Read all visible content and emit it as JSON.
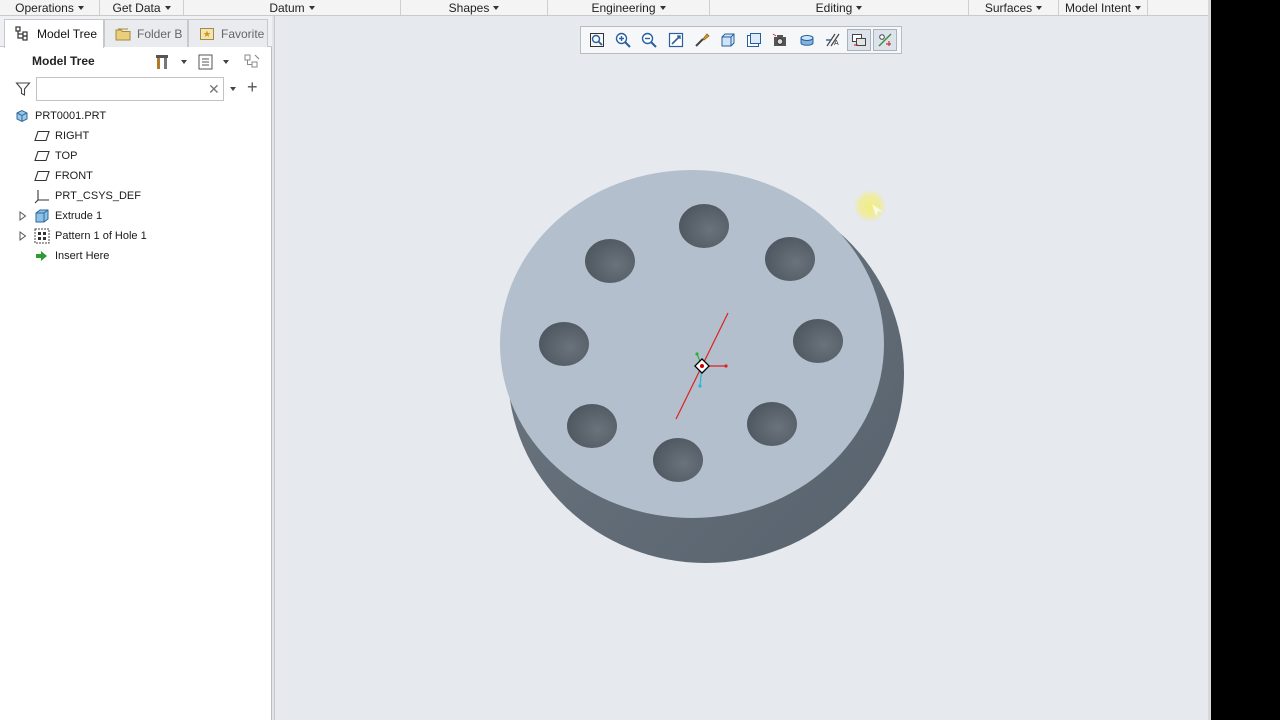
{
  "ribbon": {
    "groups": [
      {
        "label": "Operations"
      },
      {
        "label": "Get Data"
      },
      {
        "label": "Datum"
      },
      {
        "label": "Shapes"
      },
      {
        "label": "Engineering"
      },
      {
        "label": "Editing"
      },
      {
        "label": "Surfaces"
      },
      {
        "label": "Model Intent"
      }
    ]
  },
  "panel": {
    "tabs": [
      {
        "label": "Model Tree",
        "icon": "model-tree-icon",
        "active": true
      },
      {
        "label": "Folder B",
        "icon": "folder-browser-icon",
        "active": false
      },
      {
        "label": "Favorite",
        "icon": "favorites-icon",
        "active": false
      }
    ],
    "tree_title": "Model Tree",
    "search": {
      "value": "",
      "placeholder": ""
    },
    "nodes": [
      {
        "label": "PRT0001.PRT",
        "icon": "part-icon"
      },
      {
        "label": "RIGHT",
        "icon": "datum-plane-icon"
      },
      {
        "label": "TOP",
        "icon": "datum-plane-icon"
      },
      {
        "label": "FRONT",
        "icon": "datum-plane-icon"
      },
      {
        "label": "PRT_CSYS_DEF",
        "icon": "coordinate-system-icon"
      },
      {
        "label": "Extrude 1",
        "icon": "extrude-icon"
      },
      {
        "label": "Pattern 1 of Hole 1",
        "icon": "pattern-icon"
      },
      {
        "label": "Insert Here",
        "icon": "insert-arrow-icon"
      }
    ]
  },
  "graphics_toolbar": {
    "buttons": [
      "refit-icon",
      "zoom-in-icon",
      "zoom-out-icon",
      "repaint-icon",
      "display-style-icon",
      "saved-orientations-icon",
      "view-manager-icon",
      "perspective-icon",
      "section-icon",
      "datum-display-icon",
      "spin-center-icon",
      "annotation-display-icon"
    ]
  },
  "colors": {
    "viewport_bg": "#e6e9ee",
    "part_top": "#b3bfcc",
    "part_side": "#5f6a75",
    "hole": "#545d66",
    "axis": "#e02020",
    "cursor_highlight": "#f2ee7a"
  }
}
